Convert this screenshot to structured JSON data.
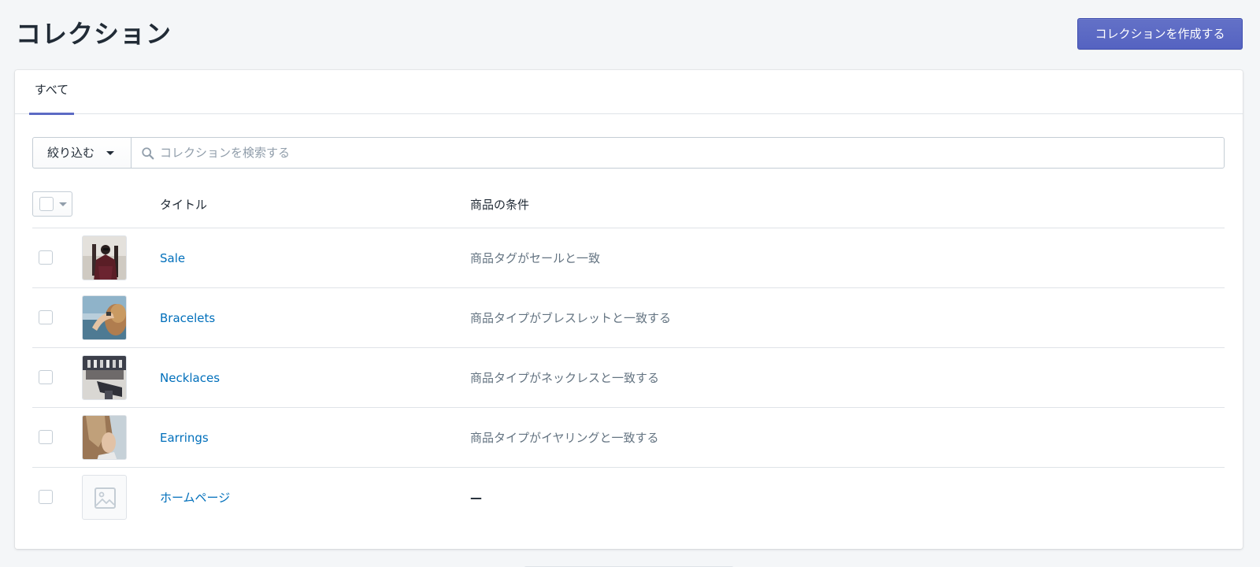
{
  "page": {
    "title": "コレクション",
    "create_button": "コレクションを作成する"
  },
  "tabs": [
    {
      "label": "すべて",
      "active": true
    }
  ],
  "filter": {
    "button_label": "絞り込む",
    "search_placeholder": "コレクションを検索する"
  },
  "table": {
    "columns": {
      "title": "タイトル",
      "conditions": "商品の条件"
    },
    "rows": [
      {
        "title": "Sale",
        "conditions": "商品タグがセールと一致",
        "image": "photo"
      },
      {
        "title": "Bracelets",
        "conditions": "商品タイプがブレスレットと一致する",
        "image": "photo"
      },
      {
        "title": "Necklaces",
        "conditions": "商品タイプがネックレスと一致する",
        "image": "photo"
      },
      {
        "title": "Earrings",
        "conditions": "商品タイプがイヤリングと一致する",
        "image": "photo"
      },
      {
        "title": "ホームページ",
        "conditions": "—",
        "image": "placeholder-image-icon"
      }
    ]
  },
  "colors": {
    "accent": "#5c6ac4",
    "link": "#006fbb",
    "muted_text": "#637381",
    "background": "#f4f6f8"
  }
}
